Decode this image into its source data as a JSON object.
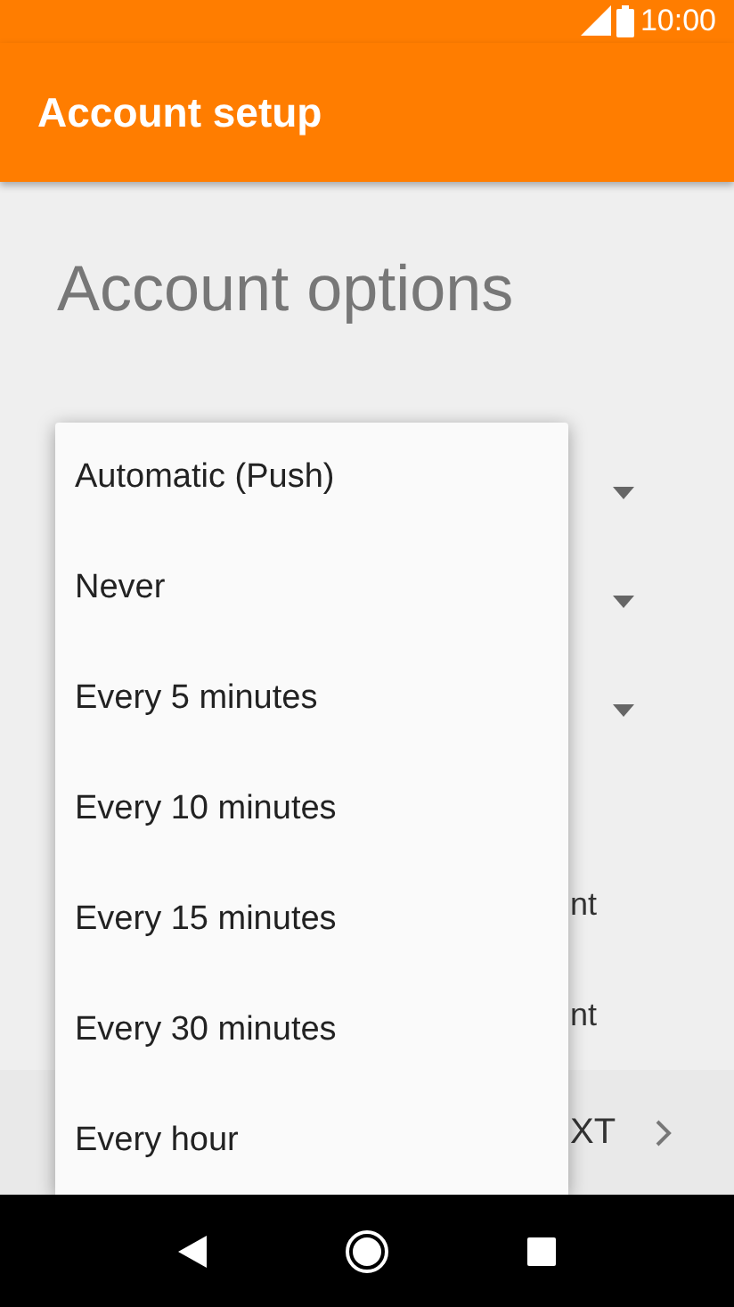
{
  "status_bar": {
    "time": "10:00"
  },
  "app_bar": {
    "title": "Account setup"
  },
  "heading": "Account options",
  "spinners": [
    {
      "kind": "dropdown"
    },
    {
      "kind": "dropdown"
    },
    {
      "kind": "dropdown"
    }
  ],
  "option_rows": [
    {
      "text": "nt"
    },
    {
      "text": "nt"
    }
  ],
  "footer": {
    "next_button": "XT"
  },
  "menu": {
    "items": [
      {
        "label": "Automatic (Push)"
      },
      {
        "label": "Never"
      },
      {
        "label": "Every 5 minutes"
      },
      {
        "label": "Every 10 minutes"
      },
      {
        "label": "Every 15 minutes"
      },
      {
        "label": "Every 30 minutes"
      },
      {
        "label": "Every hour"
      }
    ]
  }
}
